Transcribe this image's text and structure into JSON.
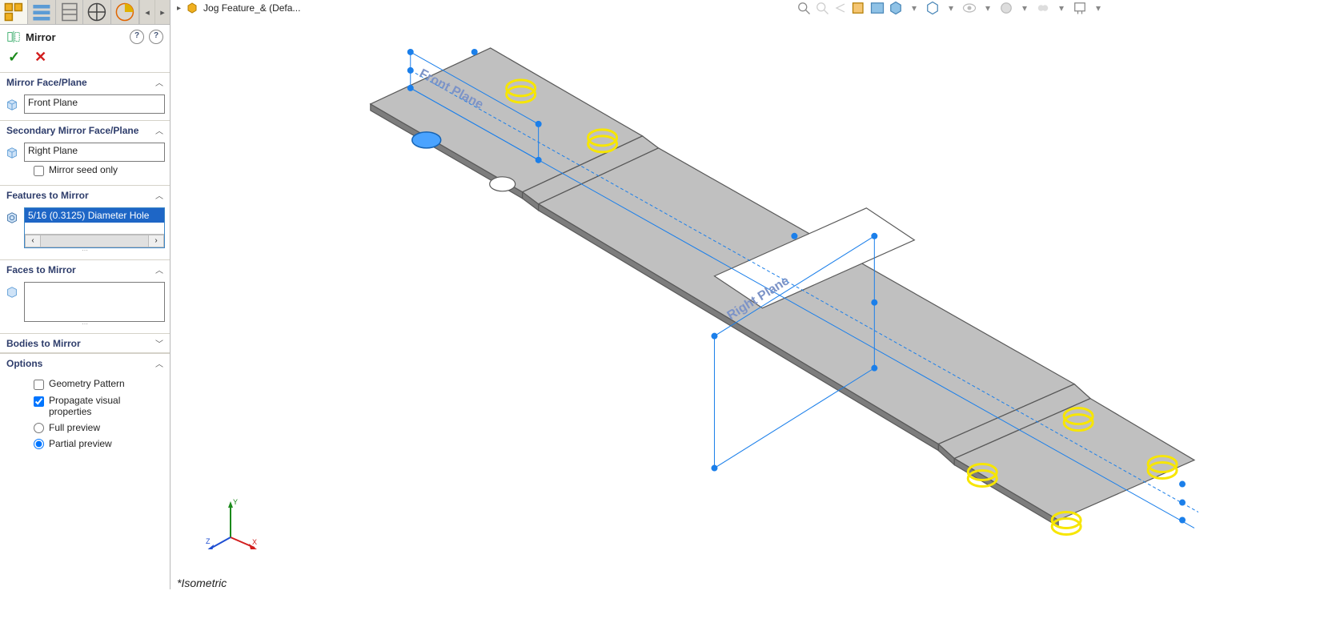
{
  "feature": {
    "title": "Mirror",
    "confirm_glyph": "✓",
    "cancel_glyph": "✕"
  },
  "breadcrumb": {
    "item": "Jog Feature_& (Defa..."
  },
  "sections": {
    "mirror_face": {
      "label": "Mirror Face/Plane",
      "value": "Front Plane"
    },
    "secondary_face": {
      "label": "Secondary Mirror Face/Plane",
      "value": "Right Plane",
      "seed_only_label": "Mirror seed only"
    },
    "features": {
      "label": "Features to Mirror",
      "items": [
        "5/16 (0.3125) Diameter Hole"
      ]
    },
    "faces": {
      "label": "Faces to Mirror"
    },
    "bodies": {
      "label": "Bodies to Mirror"
    },
    "options": {
      "label": "Options",
      "geo_label": "Geometry Pattern",
      "prop_label": "Propagate visual properties",
      "full_label": "Full preview",
      "partial_label": "Partial preview"
    }
  },
  "viewport": {
    "plane_front_label": "Front Plane",
    "plane_right_label": "Right Plane",
    "view_name": "*Isometric",
    "triad": {
      "x": "X",
      "y": "Y",
      "z": "Z"
    }
  },
  "icons": {
    "help": "?",
    "arrow_left": "◂",
    "arrow_right": "▸",
    "chev_up": "︿",
    "chev_down": "﹀",
    "scroll_left": "‹",
    "scroll_right": "›",
    "drop": "▾"
  }
}
